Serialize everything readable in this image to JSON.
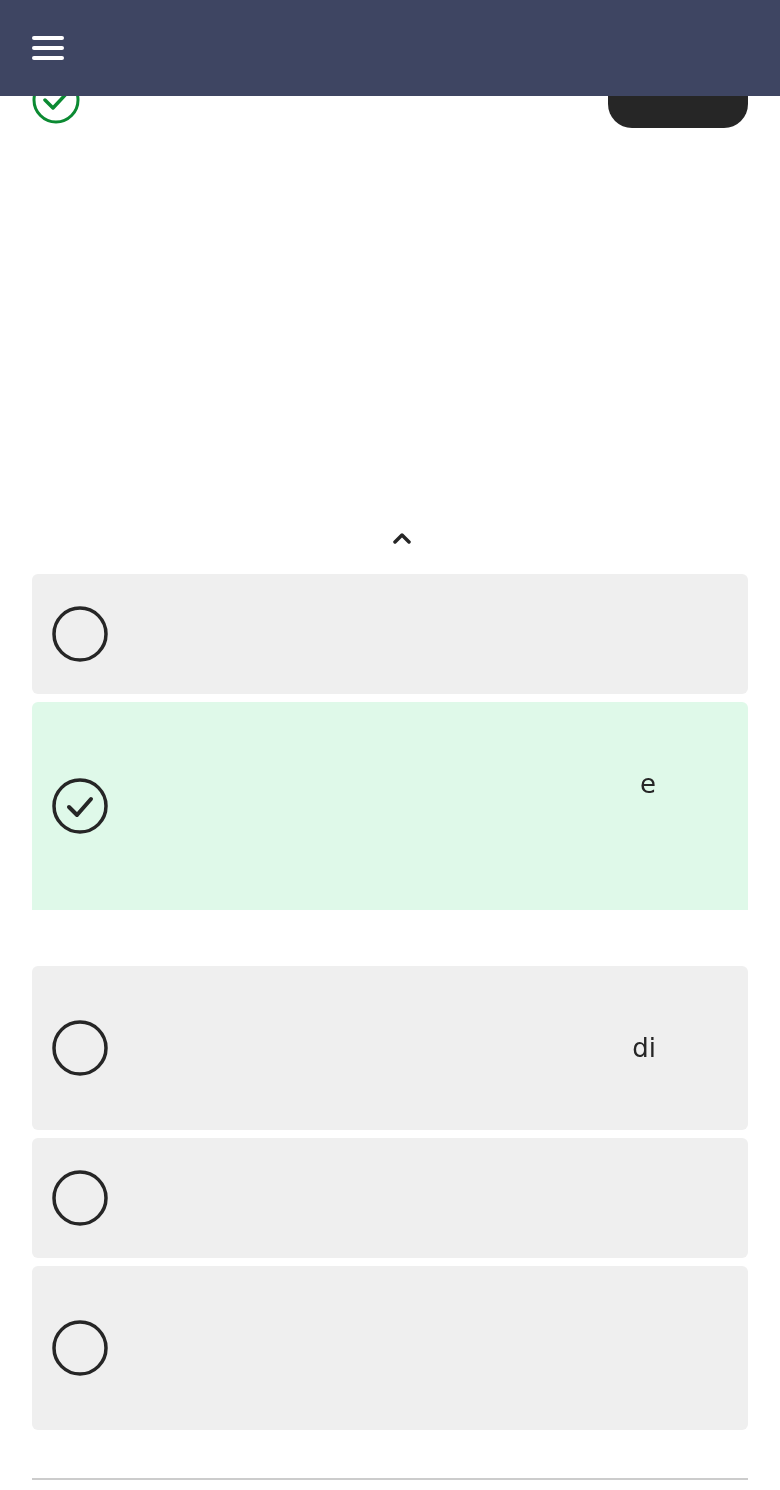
{
  "options": [
    {
      "selected": false
    },
    {
      "selected": true,
      "text": "e"
    },
    {
      "selected": false,
      "text": "di"
    },
    {
      "selected": false
    },
    {
      "selected": false
    }
  ]
}
